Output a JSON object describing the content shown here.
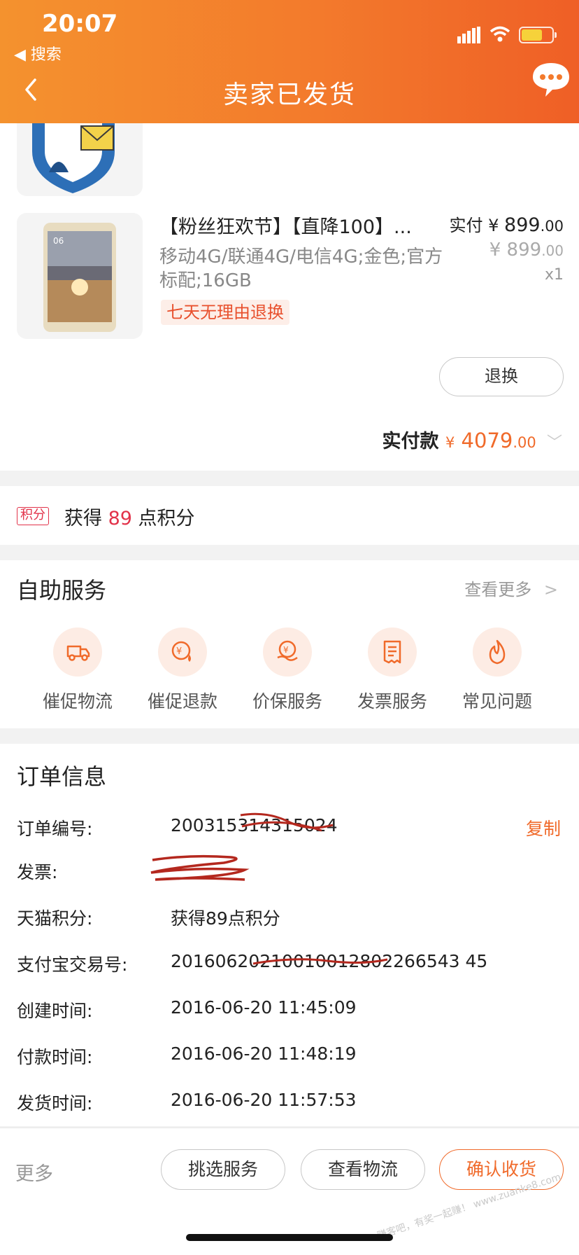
{
  "status_bar": {
    "time": "20:07",
    "back_to": "◀ 搜索"
  },
  "nav": {
    "title": "卖家已发货"
  },
  "product": {
    "title": "【粉丝狂欢节】【直降100】...",
    "spec": "移动4G/联通4G/电信4G;金色;官方标配;16GB",
    "tag": "七天无理由退换",
    "paid_label": "实付",
    "currency": "¥",
    "paid_int": "899",
    "paid_dec": ".00",
    "orig_int": "899",
    "orig_dec": ".00",
    "qty": "x1",
    "return_button": "退换"
  },
  "total": {
    "label": "实付款",
    "currency": "¥",
    "amount_int": "4079",
    "amount_dec": ".00"
  },
  "points": {
    "badge": "积分",
    "prefix": "获得",
    "value": "89",
    "suffix": "点积分"
  },
  "self_service": {
    "title": "自助服务",
    "more": "查看更多",
    "items": [
      {
        "label": "催促物流",
        "icon": "truck-icon"
      },
      {
        "label": "催促退款",
        "icon": "refund-icon"
      },
      {
        "label": "价保服务",
        "icon": "price-protect-icon"
      },
      {
        "label": "发票服务",
        "icon": "invoice-icon"
      },
      {
        "label": "常见问题",
        "icon": "fire-icon"
      }
    ]
  },
  "order_info": {
    "title": "订单信息",
    "copy": "复制",
    "rows": [
      {
        "key": "订单编号:",
        "value": "200315314315024"
      },
      {
        "key": "发票:",
        "value": ""
      },
      {
        "key": "天猫积分:",
        "value": "获得89点积分"
      },
      {
        "key": "支付宝交易号:",
        "value": "20160620210010012802266543 45"
      },
      {
        "key": "创建时间:",
        "value": "2016-06-20 11:45:09"
      },
      {
        "key": "付款时间:",
        "value": "2016-06-20 11:48:19"
      },
      {
        "key": "发货时间:",
        "value": "2016-06-20 11:57:53"
      }
    ]
  },
  "bottom_bar": {
    "more": "更多",
    "buttons": [
      "挑选服务",
      "查看物流",
      "确认收货"
    ]
  },
  "watermark": "赚客吧，有奖一起赚！ www.zuanke8.com",
  "colors": {
    "accent": "#f06a2a",
    "points_red": "#e2334a",
    "header_start": "#f4922e",
    "header_end": "#ef5f26"
  }
}
